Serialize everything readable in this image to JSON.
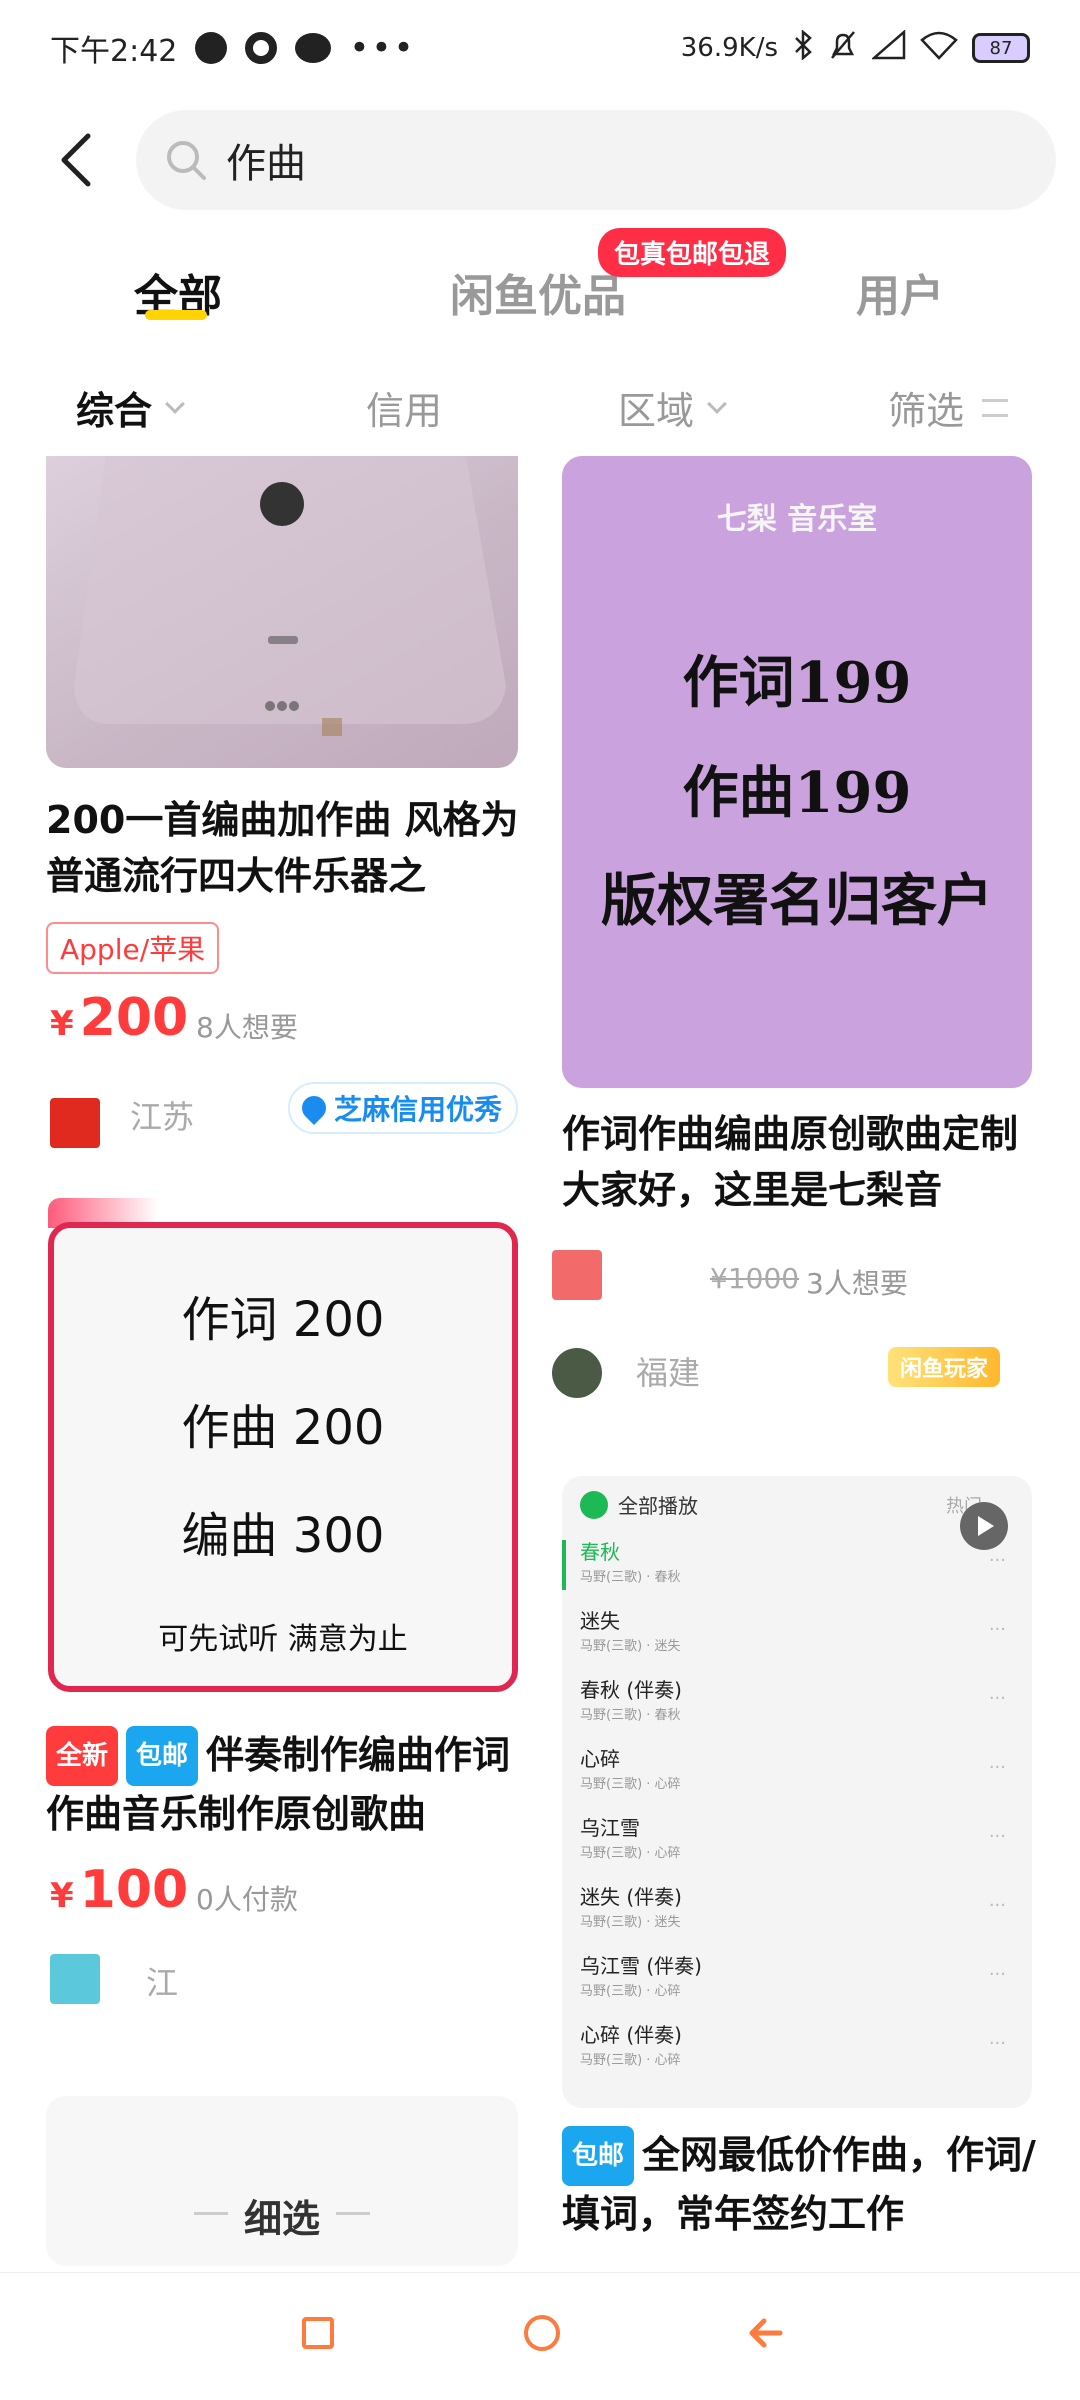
{
  "status_bar": {
    "time": "下午2:42",
    "more": "•••",
    "network_speed": "36.9K/s",
    "battery": "87",
    "icons": [
      "globe-icon",
      "gear-icon",
      "wechat-icon",
      "bluetooth-icon",
      "bell-off-icon",
      "signal-icon",
      "wifi-icon",
      "battery-icon"
    ]
  },
  "search": {
    "query": "作曲"
  },
  "tabs": {
    "all": "全部",
    "premium": "闲鱼优品",
    "users": "用户",
    "premium_badge": "包真包邮包退"
  },
  "filters": {
    "overall": "综合",
    "credit": "信用",
    "region": "区域",
    "filter": "筛选"
  },
  "items": [
    {
      "title": "200一首编曲加作曲 风格为普通流行四大件乐器之",
      "brand_tag": "Apple/苹果",
      "price_symbol": "¥",
      "price": "200",
      "wants": "8人想要",
      "location": "江苏",
      "credit_badge": "芝麻信用优秀"
    },
    {
      "image_top": "七梨        音乐室",
      "image_lines": [
        "作词199",
        "作曲199",
        "版权署名归客户"
      ],
      "title": "作词作曲编曲原创歌曲定制 大家好，这里是七梨音",
      "old_price": "¥1000",
      "wants": "3人想要",
      "location": "福建",
      "badge": "闲鱼玩家"
    },
    {
      "image_lines": [
        "作词 200",
        "作曲 200",
        "编曲 300"
      ],
      "image_note": "可先试听 满意为止",
      "tag_new": "全新",
      "tag_free_ship": "包邮",
      "title": "伴奏制作编曲作词作曲音乐制作原创歌曲",
      "price_symbol": "¥",
      "price": "100",
      "paid": "0人付款",
      "location": "江"
    },
    {
      "playlist_header": "全部播放",
      "playlist_hot": "热门",
      "playlist": [
        {
          "name": "春秋",
          "sub": "马野(三歌) · 春秋"
        },
        {
          "name": "迷失",
          "sub": "马野(三歌) · 迷失"
        },
        {
          "name": "春秋 (伴奏)",
          "sub": "马野(三歌) · 春秋"
        },
        {
          "name": "心碎",
          "sub": "马野(三歌) · 心碎"
        },
        {
          "name": "乌江雪",
          "sub": "马野(三歌) · 心碎"
        },
        {
          "name": "迷失 (伴奏)",
          "sub": "马野(三歌) · 迷失"
        },
        {
          "name": "乌江雪 (伴奏)",
          "sub": "马野(三歌) · 心碎"
        },
        {
          "name": "心碎 (伴奏)",
          "sub": "马野(三歌) · 心碎"
        }
      ],
      "tag_free_ship": "包邮",
      "title": "全网最低价作曲，作词/填词，常年签约工作"
    }
  ],
  "fine_filter": "细选",
  "colors": {
    "accent_red": "#ff3b3b",
    "tab_underline": "#ffd400",
    "nav_orange": "#ff7a3d"
  }
}
